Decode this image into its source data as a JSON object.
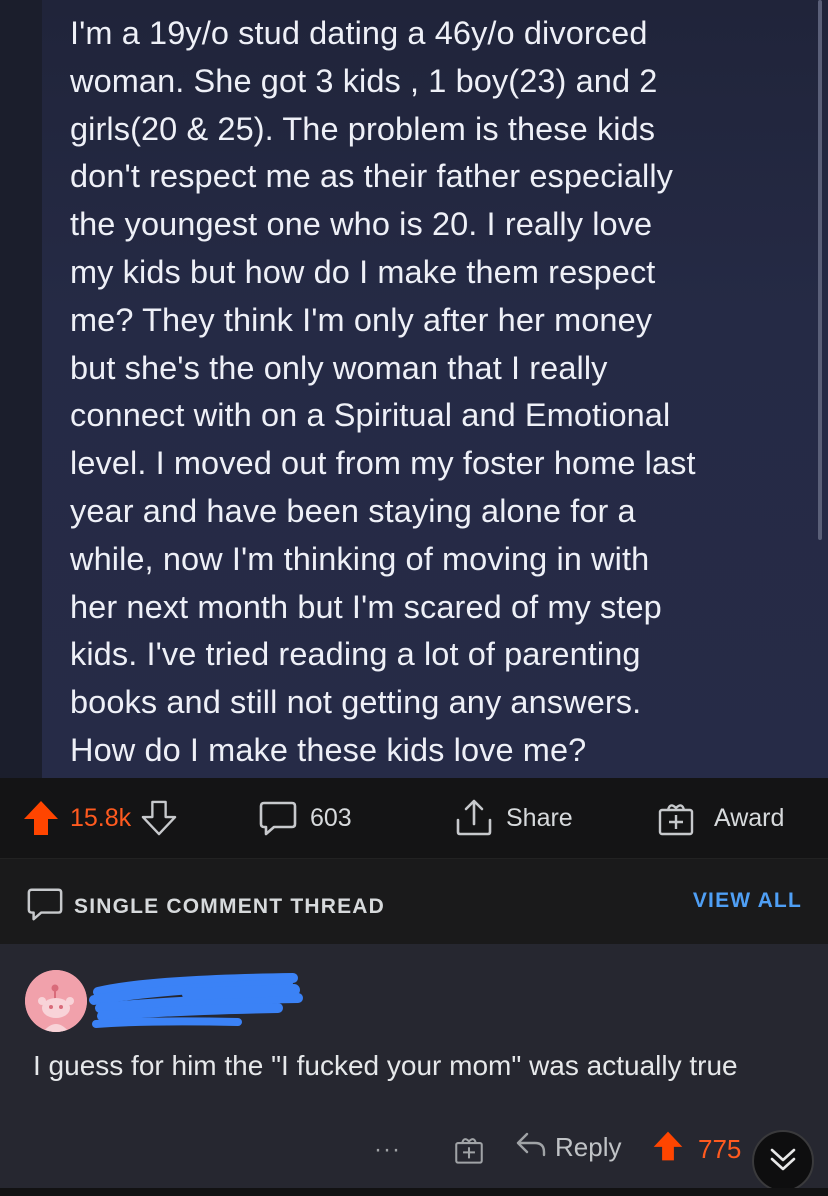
{
  "post": {
    "text": "I'm a 19y/o stud dating a 46y/o divorced\nwoman. She got 3 kids , 1 boy(23) and 2\ngirls(20 & 25). The problem is these kids\ndon't respect me as their father especially\nthe youngest one who is 20. I really love\nmy kids but how do I make them respect\nme? They think I'm only after her money\nbut she's the only woman that I really\nconnect with on a Spiritual and Emotional\nlevel. I moved out from my foster home last\nyear and have been staying alone for a\nwhile, now I'm thinking of moving in with\nher next month but I'm scared of my step\nkids. I've tried reading a lot of parenting\nbooks and still not getting any answers.\nHow do I make these kids love me?"
  },
  "actions": {
    "upvotes": "15.8k",
    "comments": "603",
    "share_label": "Share",
    "award_label": "Award"
  },
  "thread": {
    "title": "SINGLE COMMENT THREAD",
    "view_all": "VIEW ALL"
  },
  "comment": {
    "text": "I guess for him the \"I fucked your mom\" was actually true",
    "more": "···",
    "reply_label": "Reply",
    "votes": "775"
  },
  "colors": {
    "upvote": "#ff4500",
    "link": "#4f9ff5",
    "redact": "#3b82f6"
  },
  "icons": [
    "upvote-icon",
    "downvote-icon",
    "comment-icon",
    "share-icon",
    "award-icon",
    "reply-icon",
    "chevron-down-icon",
    "snoo-avatar"
  ]
}
